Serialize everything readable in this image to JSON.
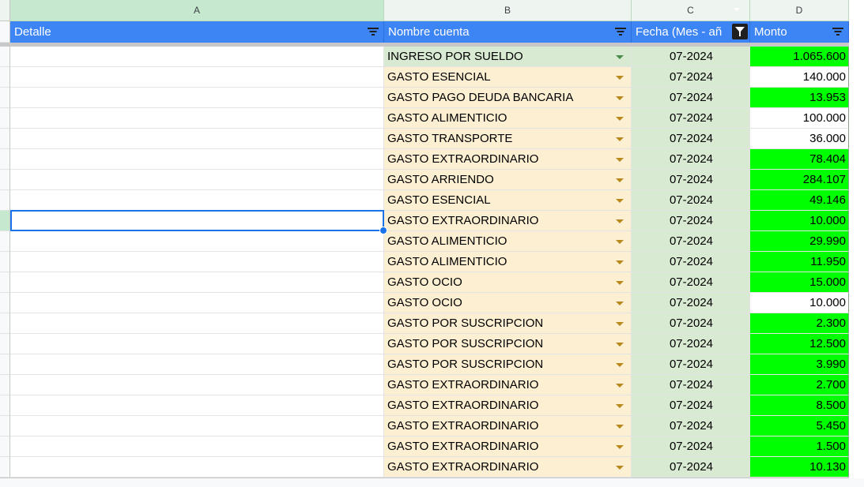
{
  "columns": [
    "A",
    "B",
    "C",
    "D"
  ],
  "header": {
    "detalle": "Detalle",
    "nombre_cuenta": "Nombre cuenta",
    "fecha": "Fecha (Mes - añ",
    "monto": "Monto"
  },
  "colors": {
    "header_blue": "#3d85f5",
    "account_fill": "#fdefd2",
    "date_fill": "#d9ead3",
    "amount_highlight": "#00ff00",
    "selection": "#1a73e8"
  },
  "rows": [
    {
      "cuenta": "INGRESO POR SUELDO",
      "fecha": "07-2024",
      "monto": "1.065.600",
      "highlight": true
    },
    {
      "cuenta": "GASTO ESENCIAL",
      "fecha": "07-2024",
      "monto": "140.000",
      "highlight": false
    },
    {
      "cuenta": "GASTO PAGO DEUDA BANCARIA",
      "fecha": "07-2024",
      "monto": "13.953",
      "highlight": true
    },
    {
      "cuenta": "GASTO ALIMENTICIO",
      "fecha": "07-2024",
      "monto": "100.000",
      "highlight": false
    },
    {
      "cuenta": "GASTO TRANSPORTE",
      "fecha": "07-2024",
      "monto": "36.000",
      "highlight": false
    },
    {
      "cuenta": "GASTO EXTRAORDINARIO",
      "fecha": "07-2024",
      "monto": "78.404",
      "highlight": true
    },
    {
      "cuenta": "GASTO ARRIENDO",
      "fecha": "07-2024",
      "monto": "284.107",
      "highlight": true
    },
    {
      "cuenta": "GASTO ESENCIAL",
      "fecha": "07-2024",
      "monto": "49.146",
      "highlight": true
    },
    {
      "cuenta": "GASTO EXTRAORDINARIO",
      "fecha": "07-2024",
      "monto": "10.000",
      "highlight": true
    },
    {
      "cuenta": "GASTO ALIMENTICIO",
      "fecha": "07-2024",
      "monto": "29.990",
      "highlight": true
    },
    {
      "cuenta": "GASTO ALIMENTICIO",
      "fecha": "07-2024",
      "monto": "11.950",
      "highlight": true
    },
    {
      "cuenta": "GASTO OCIO",
      "fecha": "07-2024",
      "monto": "15.000",
      "highlight": true
    },
    {
      "cuenta": "GASTO OCIO",
      "fecha": "07-2024",
      "monto": "10.000",
      "highlight": false
    },
    {
      "cuenta": "GASTO POR SUSCRIPCION",
      "fecha": "07-2024",
      "monto": "2.300",
      "highlight": true
    },
    {
      "cuenta": "GASTO POR SUSCRIPCION",
      "fecha": "07-2024",
      "monto": "12.500",
      "highlight": true
    },
    {
      "cuenta": "GASTO POR SUSCRIPCION",
      "fecha": "07-2024",
      "monto": "3.990",
      "highlight": true
    },
    {
      "cuenta": "GASTO EXTRAORDINARIO",
      "fecha": "07-2024",
      "monto": "2.700",
      "highlight": true
    },
    {
      "cuenta": "GASTO EXTRAORDINARIO",
      "fecha": "07-2024",
      "monto": "8.500",
      "highlight": true
    },
    {
      "cuenta": "GASTO EXTRAORDINARIO",
      "fecha": "07-2024",
      "monto": "5.450",
      "highlight": true
    },
    {
      "cuenta": "GASTO EXTRAORDINARIO",
      "fecha": "07-2024",
      "monto": "1.500",
      "highlight": true
    },
    {
      "cuenta": "GASTO EXTRAORDINARIO",
      "fecha": "07-2024",
      "monto": "10.130",
      "highlight": true
    }
  ]
}
